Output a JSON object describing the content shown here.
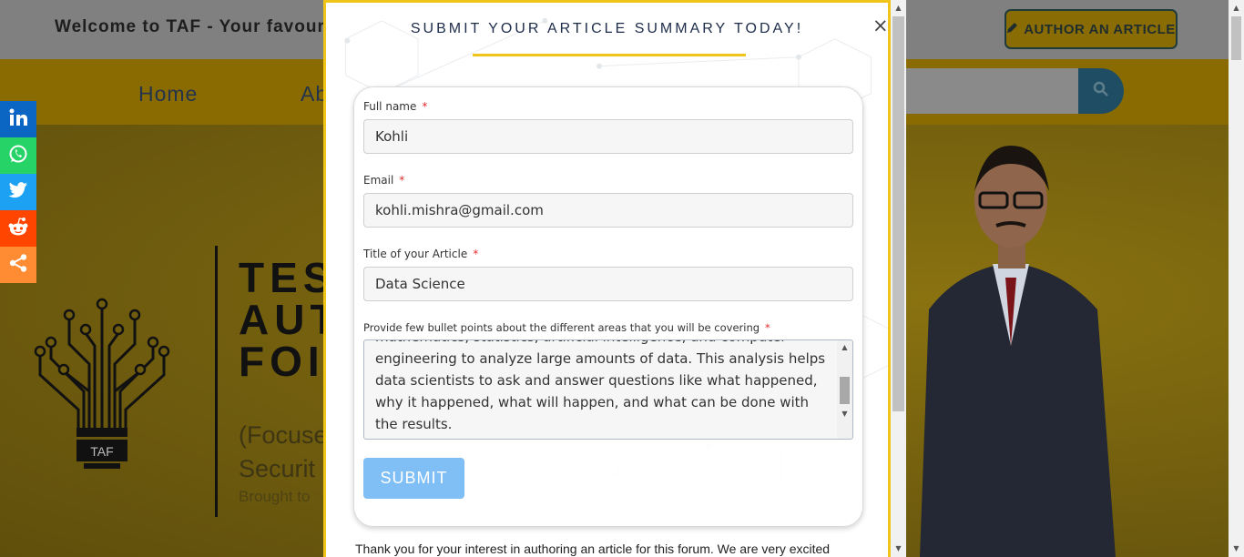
{
  "header": {
    "welcome_text": "Welcome to TAF - Your favour",
    "author_button": "AUTHOR AN ARTICLE"
  },
  "nav": {
    "home": "Home",
    "about": "Ab"
  },
  "hero": {
    "title_lines": [
      "TES",
      "AUT",
      "FOI"
    ],
    "subtitle_lines": [
      "(Focuse",
      "Securit"
    ],
    "brought": "Brought to",
    "logo_text": "TAF"
  },
  "social": [
    "linkedin-icon",
    "whatsapp-icon",
    "twitter-icon",
    "reddit-icon",
    "share-icon"
  ],
  "modal": {
    "title": "SUBMIT YOUR ARTICLE SUMMARY TODAY!",
    "close": "×",
    "fields": {
      "full_name": {
        "label": "Full name",
        "required": "*",
        "value": "Kohli"
      },
      "email": {
        "label": "Email",
        "required": "*",
        "value": "kohli.mishra@gmail.com"
      },
      "article_title": {
        "label": "Title of your Article",
        "required": "*",
        "value": "Data Science"
      },
      "bullets": {
        "label": "Provide few bullet points about the different areas that you will be covering",
        "required": "*",
        "value": "mathematics, statistics, artificial intelligence, and computer engineering to analyze large amounts of data. This analysis helps data scientists to ask and answer questions like what happened, why it happened, what will happen, and what can be done with the results."
      }
    },
    "submit": "SUBMIT",
    "thank_you": "Thank you for your interest in authoring an article for this forum. We are very excited"
  },
  "colors": {
    "accent": "#f0c419",
    "submit": "#7fbff5",
    "title": "#1d2c4a",
    "required": "#e02b2b"
  }
}
